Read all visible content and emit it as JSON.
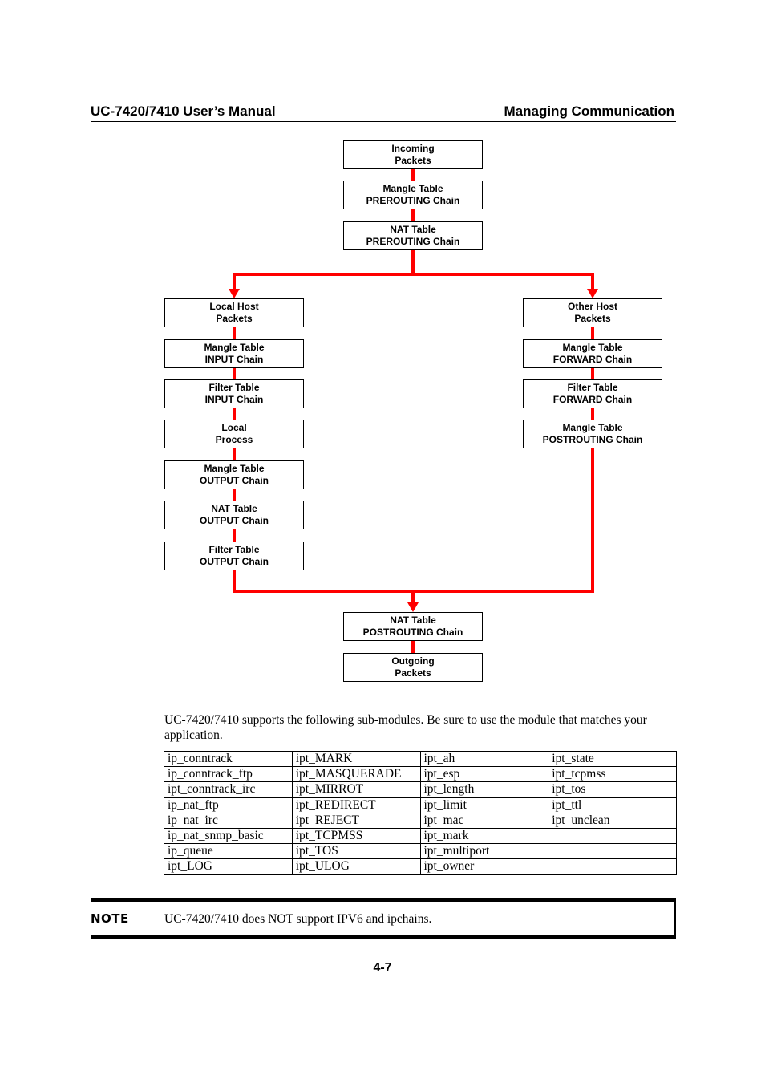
{
  "header": {
    "left": "UC-7420/7410 User’s Manual",
    "right": "Managing Communication"
  },
  "diagram": {
    "line_color": "#ff0000",
    "top": [
      {
        "line1": "Incoming",
        "line2": "Packets"
      },
      {
        "line1": "Mangle Table",
        "line2": "PREROUTING Chain"
      },
      {
        "line1": "NAT Table",
        "line2": "PREROUTING Chain"
      }
    ],
    "left": [
      {
        "line1": "Local Host",
        "line2": "Packets"
      },
      {
        "line1": "Mangle Table",
        "line2": "INPUT Chain"
      },
      {
        "line1": "Filter Table",
        "line2": "INPUT Chain"
      },
      {
        "line1": "Local",
        "line2": "Process"
      },
      {
        "line1": "Mangle Table",
        "line2": "OUTPUT Chain"
      },
      {
        "line1": "NAT Table",
        "line2": "OUTPUT Chain"
      },
      {
        "line1": "Filter Table",
        "line2": "OUTPUT Chain"
      }
    ],
    "right": [
      {
        "line1": "Other Host",
        "line2": "Packets"
      },
      {
        "line1": "Mangle Table",
        "line2": "FORWARD Chain"
      },
      {
        "line1": "Filter Table",
        "line2": "FORWARD Chain"
      },
      {
        "line1": "Mangle Table",
        "line2": "POSTROUTING Chain"
      }
    ],
    "bottom": [
      {
        "line1": "NAT Table",
        "line2": "POSTROUTING Chain"
      },
      {
        "line1": "Outgoing",
        "line2": "Packets"
      }
    ]
  },
  "intro": "UC-7420/7410 supports the following sub-modules. Be sure to use the module that matches your application.",
  "modules": [
    [
      "ip_conntrack",
      "ipt_MARK",
      "ipt_ah",
      "ipt_state"
    ],
    [
      "ip_conntrack_ftp",
      "ipt_MASQUERADE",
      "ipt_esp",
      "ipt_tcpmss"
    ],
    [
      "ipt_conntrack_irc",
      "ipt_MIRROT",
      "ipt_length",
      "ipt_tos"
    ],
    [
      "ip_nat_ftp",
      "ipt_REDIRECT",
      "ipt_limit",
      "ipt_ttl"
    ],
    [
      "ip_nat_irc",
      "ipt_REJECT",
      "ipt_mac",
      "ipt_unclean"
    ],
    [
      "ip_nat_snmp_basic",
      "ipt_TCPMSS",
      "ipt_mark",
      ""
    ],
    [
      "ip_queue",
      "ipt_TOS",
      "ipt_multiport",
      ""
    ],
    [
      "ipt_LOG",
      "ipt_ULOG",
      "ipt_owner",
      ""
    ]
  ],
  "note": {
    "label": "NOTE",
    "text": "UC-7420/7410 does NOT support IPV6 and ipchains."
  },
  "page_number": "4-7"
}
